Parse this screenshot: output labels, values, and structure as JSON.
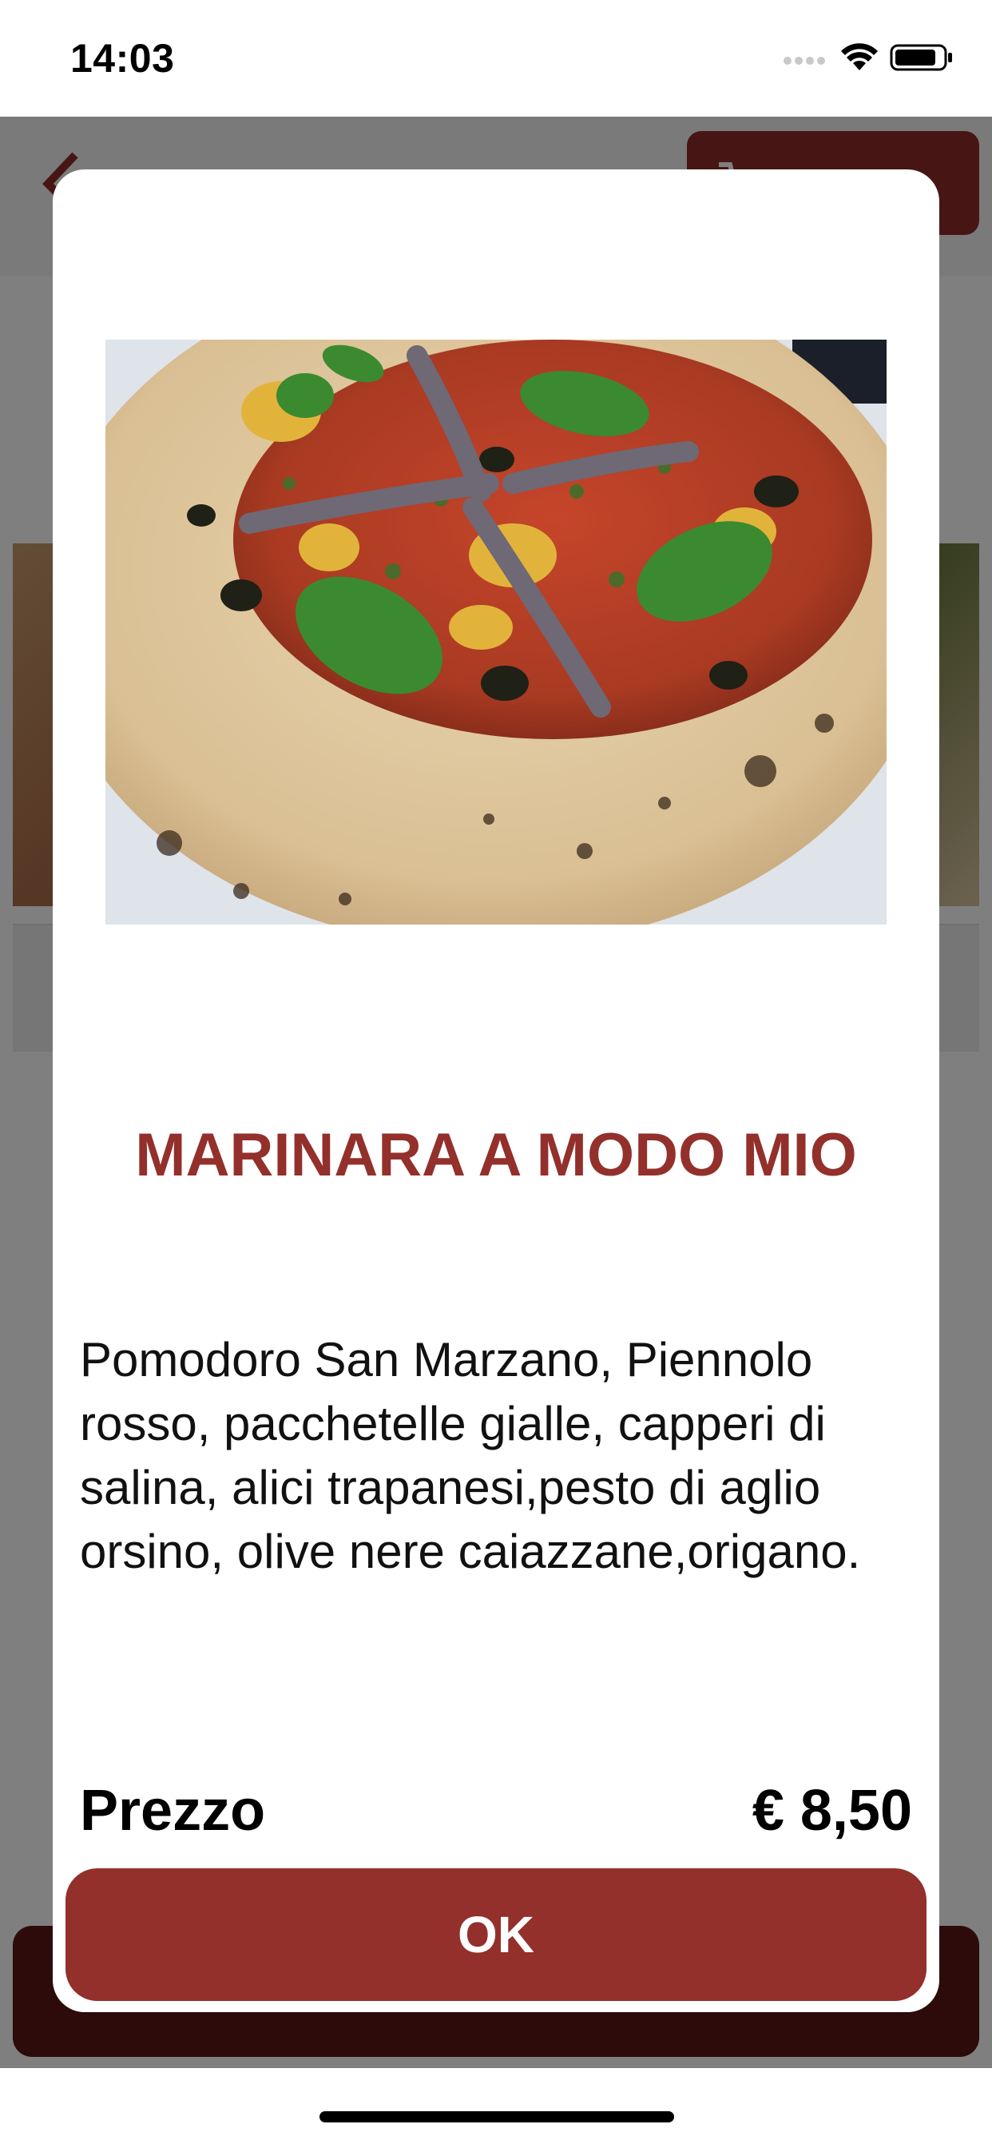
{
  "status_bar": {
    "time": "14:03",
    "icons": [
      "cellular-signal-icon",
      "wifi-icon",
      "battery-icon"
    ]
  },
  "background_screen": {
    "back_icon": "chevron-left-icon",
    "cart": {
      "icon": "cart-icon"
    }
  },
  "modal": {
    "image": {
      "subject": "pizza marinara photo"
    },
    "title": "MARINARA A MODO MIO",
    "description": "Pomodoro San Marzano, Piennolo rosso, pacchetelle gialle, capperi di salina, alici trapanesi,pesto di aglio orsino, olive nere caiazzane,origano.",
    "price_label": "Prezzo",
    "price_value": "€ 8,50",
    "ok_label": "OK"
  },
  "colors": {
    "accent": "#93302c",
    "overlay": "rgba(0,0,0,0.5)"
  }
}
